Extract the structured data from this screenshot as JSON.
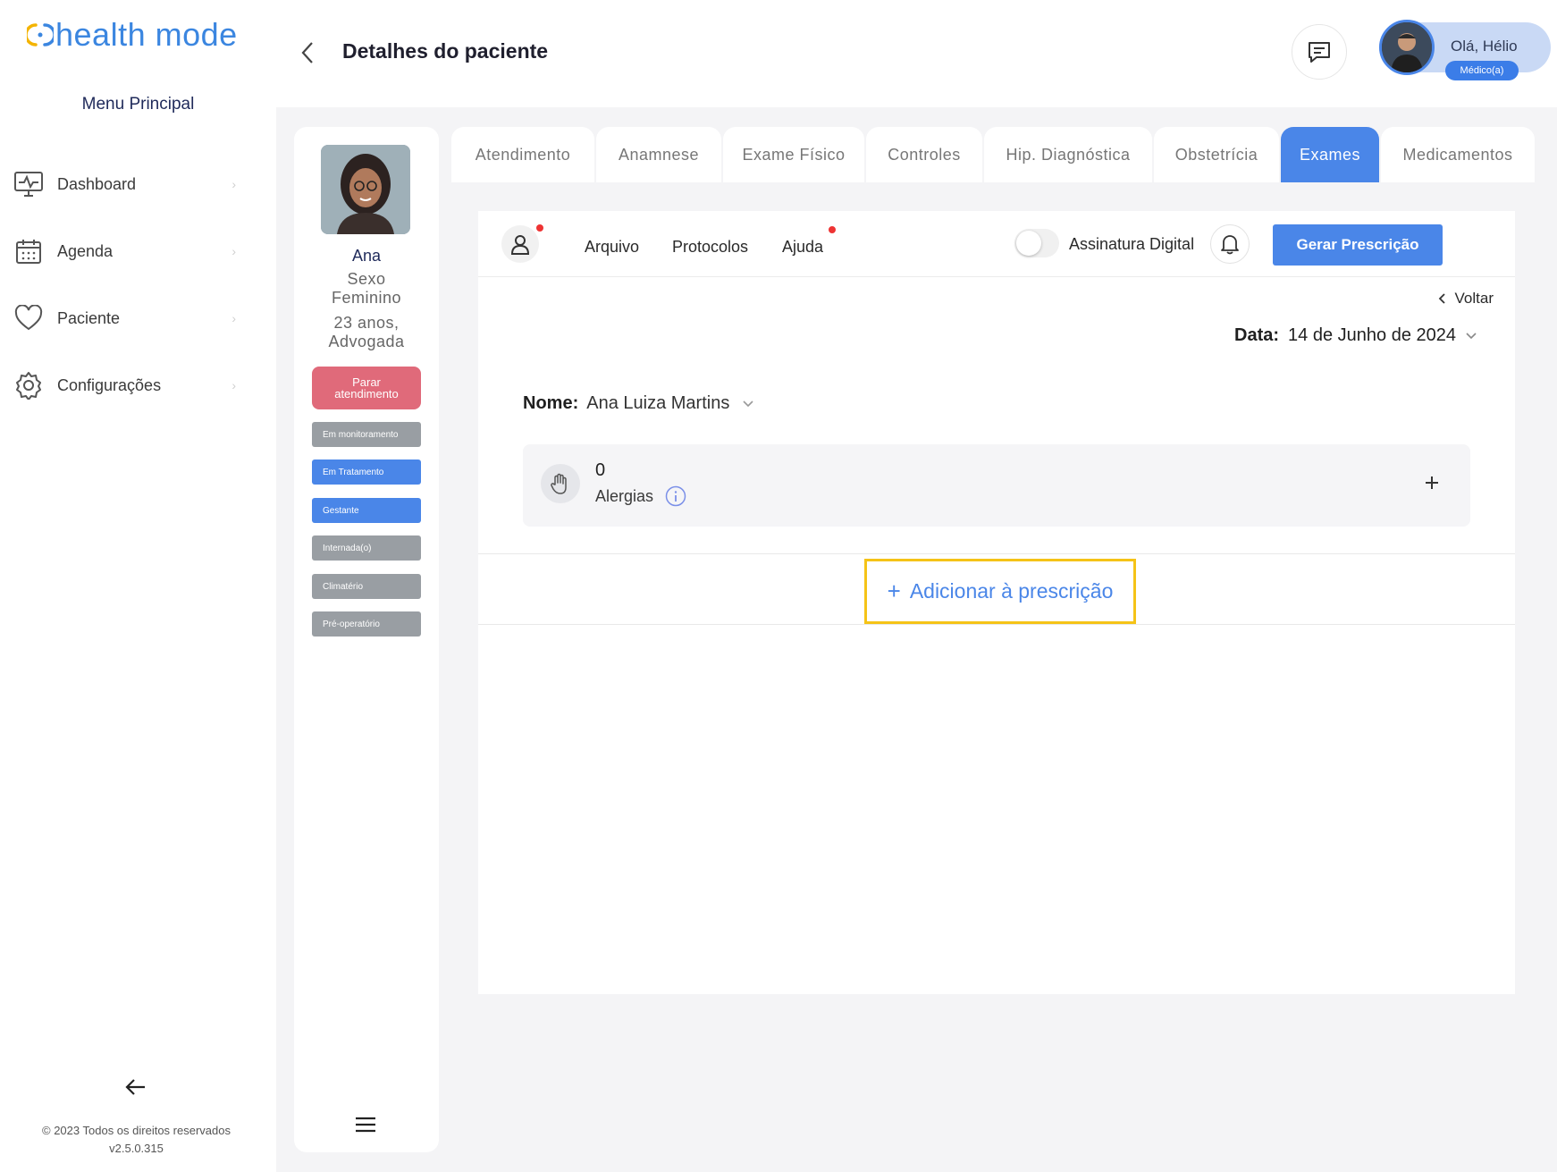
{
  "brand": {
    "name": "health mode",
    "accent": "#4a86e8"
  },
  "sidebar": {
    "title": "Menu Principal",
    "items": [
      {
        "label": "Dashboard",
        "icon": "monitor-pulse-icon"
      },
      {
        "label": "Agenda",
        "icon": "calendar-icon"
      },
      {
        "label": "Paciente",
        "icon": "heart-icon"
      },
      {
        "label": "Configurações",
        "icon": "gear-icon"
      }
    ],
    "copyright": "© 2023 Todos os direitos reservados",
    "version": "v2.5.0.315"
  },
  "header": {
    "title": "Detalhes do paciente",
    "greeting": "Olá, Hélio",
    "role": "Médico(a)"
  },
  "patient": {
    "name": "Ana",
    "sex_label": "Sexo",
    "sex": "Feminino",
    "age": "23 anos,",
    "occupation": "Advogada",
    "stop_button_line1": "Parar",
    "stop_button_line2": "atendimento",
    "statuses": [
      {
        "label": "Em monitoramento",
        "active": false
      },
      {
        "label": "Em Tratamento",
        "active": true
      },
      {
        "label": "Gestante",
        "active": true
      },
      {
        "label": "Internada(o)",
        "active": false
      },
      {
        "label": "Climatério",
        "active": false
      },
      {
        "label": "Pré-operatório",
        "active": false
      }
    ]
  },
  "tabs": [
    {
      "label": "Atendimento",
      "active": false
    },
    {
      "label": "Anamnese",
      "active": false
    },
    {
      "label": "Exame Físico",
      "active": false
    },
    {
      "label": "Controles",
      "active": false
    },
    {
      "label": "Hip. Diagnóstica",
      "active": false
    },
    {
      "label": "Obstetrícia",
      "active": false
    },
    {
      "label": "Exames",
      "active": true
    },
    {
      "label": "Medicamentos",
      "active": false
    }
  ],
  "toolbar": {
    "arquivo": "Arquivo",
    "protocolos": "Protocolos",
    "ajuda": "Ajuda",
    "assinatura": "Assinatura Digital",
    "assinatura_enabled": false,
    "generate": "Gerar Prescrição"
  },
  "prescription": {
    "back": "Voltar",
    "date_label": "Data:",
    "date_value": "14 de Junho de 2024",
    "name_label": "Nome:",
    "name_value": "Ana Luiza Martins",
    "allergy_count": "0",
    "allergy_label": "Alergias",
    "add_plus": "+",
    "add_label": "Adicionar à prescrição"
  }
}
